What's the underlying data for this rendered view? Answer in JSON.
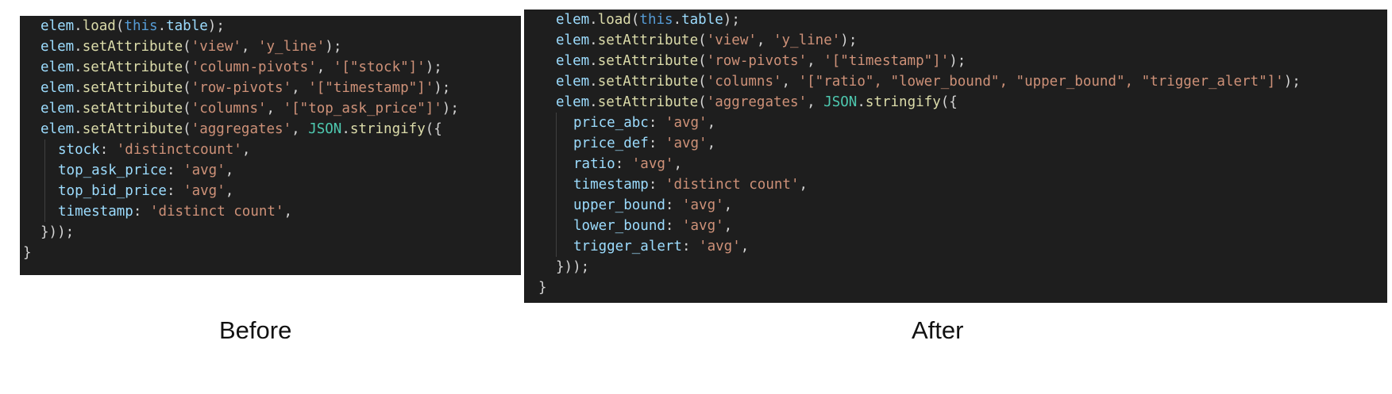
{
  "colors": {
    "background": "#1e1e1e",
    "default": "#d4d4d4",
    "identifier": "#9cdcfe",
    "keyword": "#569cd6",
    "function": "#dcdcaa",
    "string": "#ce9178",
    "class": "#4ec9b0",
    "punctuation": "#d4d4d4",
    "guide": "#404040"
  },
  "panels": [
    {
      "id": "before",
      "caption": "Before",
      "lines": [
        {
          "indent": 1,
          "tokens": [
            [
              "identifier",
              "elem"
            ],
            [
              "punctuation",
              "."
            ],
            [
              "function",
              "load"
            ],
            [
              "punctuation",
              "("
            ],
            [
              "keyword",
              "this"
            ],
            [
              "punctuation",
              "."
            ],
            [
              "identifier",
              "table"
            ],
            [
              "punctuation",
              ");"
            ]
          ]
        },
        {
          "indent": 1,
          "tokens": [
            [
              "identifier",
              "elem"
            ],
            [
              "punctuation",
              "."
            ],
            [
              "function",
              "setAttribute"
            ],
            [
              "punctuation",
              "("
            ],
            [
              "string",
              "'view'"
            ],
            [
              "punctuation",
              ", "
            ],
            [
              "string",
              "'y_line'"
            ],
            [
              "punctuation",
              ");"
            ]
          ]
        },
        {
          "indent": 1,
          "tokens": [
            [
              "identifier",
              "elem"
            ],
            [
              "punctuation",
              "."
            ],
            [
              "function",
              "setAttribute"
            ],
            [
              "punctuation",
              "("
            ],
            [
              "string",
              "'column-pivots'"
            ],
            [
              "punctuation",
              ", "
            ],
            [
              "string",
              "'[\"stock\"]'"
            ],
            [
              "punctuation",
              ");"
            ]
          ]
        },
        {
          "indent": 1,
          "tokens": [
            [
              "identifier",
              "elem"
            ],
            [
              "punctuation",
              "."
            ],
            [
              "function",
              "setAttribute"
            ],
            [
              "punctuation",
              "("
            ],
            [
              "string",
              "'row-pivots'"
            ],
            [
              "punctuation",
              ", "
            ],
            [
              "string",
              "'[\"timestamp\"]'"
            ],
            [
              "punctuation",
              ");"
            ]
          ]
        },
        {
          "indent": 1,
          "tokens": [
            [
              "identifier",
              "elem"
            ],
            [
              "punctuation",
              "."
            ],
            [
              "function",
              "setAttribute"
            ],
            [
              "punctuation",
              "("
            ],
            [
              "string",
              "'columns'"
            ],
            [
              "punctuation",
              ", "
            ],
            [
              "string",
              "'[\"top_ask_price\"]'"
            ],
            [
              "punctuation",
              ");"
            ]
          ]
        },
        {
          "indent": 1,
          "tokens": [
            [
              "identifier",
              "elem"
            ],
            [
              "punctuation",
              "."
            ],
            [
              "function",
              "setAttribute"
            ],
            [
              "punctuation",
              "("
            ],
            [
              "string",
              "'aggregates'"
            ],
            [
              "punctuation",
              ", "
            ],
            [
              "class",
              "JSON"
            ],
            [
              "punctuation",
              "."
            ],
            [
              "function",
              "stringify"
            ],
            [
              "punctuation",
              "({"
            ]
          ]
        },
        {
          "indent": 2,
          "tokens": [
            [
              "identifier",
              "stock"
            ],
            [
              "punctuation",
              ": "
            ],
            [
              "string",
              "'distinctcount'"
            ],
            [
              "punctuation",
              ","
            ]
          ]
        },
        {
          "indent": 2,
          "tokens": [
            [
              "identifier",
              "top_ask_price"
            ],
            [
              "punctuation",
              ": "
            ],
            [
              "string",
              "'avg'"
            ],
            [
              "punctuation",
              ","
            ]
          ]
        },
        {
          "indent": 2,
          "tokens": [
            [
              "identifier",
              "top_bid_price"
            ],
            [
              "punctuation",
              ": "
            ],
            [
              "string",
              "'avg'"
            ],
            [
              "punctuation",
              ","
            ]
          ]
        },
        {
          "indent": 2,
          "tokens": [
            [
              "identifier",
              "timestamp"
            ],
            [
              "punctuation",
              ": "
            ],
            [
              "string",
              "'distinct count'"
            ],
            [
              "punctuation",
              ","
            ]
          ]
        },
        {
          "indent": 1,
          "tokens": [
            [
              "punctuation",
              "}));"
            ]
          ]
        },
        {
          "indent": 0,
          "tokens": [
            [
              "punctuation",
              "}"
            ]
          ]
        }
      ]
    },
    {
      "id": "after",
      "caption": "After",
      "lines": [
        {
          "indent": 1,
          "tokens": [
            [
              "identifier",
              "elem"
            ],
            [
              "punctuation",
              "."
            ],
            [
              "function",
              "load"
            ],
            [
              "punctuation",
              "("
            ],
            [
              "keyword",
              "this"
            ],
            [
              "punctuation",
              "."
            ],
            [
              "identifier",
              "table"
            ],
            [
              "punctuation",
              ");"
            ]
          ]
        },
        {
          "indent": 1,
          "tokens": [
            [
              "identifier",
              "elem"
            ],
            [
              "punctuation",
              "."
            ],
            [
              "function",
              "setAttribute"
            ],
            [
              "punctuation",
              "("
            ],
            [
              "string",
              "'view'"
            ],
            [
              "punctuation",
              ", "
            ],
            [
              "string",
              "'y_line'"
            ],
            [
              "punctuation",
              ");"
            ]
          ]
        },
        {
          "indent": 1,
          "tokens": [
            [
              "identifier",
              "elem"
            ],
            [
              "punctuation",
              "."
            ],
            [
              "function",
              "setAttribute"
            ],
            [
              "punctuation",
              "("
            ],
            [
              "string",
              "'row-pivots'"
            ],
            [
              "punctuation",
              ", "
            ],
            [
              "string",
              "'[\"timestamp\"]'"
            ],
            [
              "punctuation",
              ");"
            ]
          ]
        },
        {
          "indent": 1,
          "tokens": [
            [
              "identifier",
              "elem"
            ],
            [
              "punctuation",
              "."
            ],
            [
              "function",
              "setAttribute"
            ],
            [
              "punctuation",
              "("
            ],
            [
              "string",
              "'columns'"
            ],
            [
              "punctuation",
              ", "
            ],
            [
              "string",
              "'[\"ratio\", \"lower_bound\", \"upper_bound\", \"trigger_alert\"]'"
            ],
            [
              "punctuation",
              ");"
            ]
          ]
        },
        {
          "indent": 1,
          "tokens": [
            [
              "identifier",
              "elem"
            ],
            [
              "punctuation",
              "."
            ],
            [
              "function",
              "setAttribute"
            ],
            [
              "punctuation",
              "("
            ],
            [
              "string",
              "'aggregates'"
            ],
            [
              "punctuation",
              ", "
            ],
            [
              "class",
              "JSON"
            ],
            [
              "punctuation",
              "."
            ],
            [
              "function",
              "stringify"
            ],
            [
              "punctuation",
              "({"
            ]
          ]
        },
        {
          "indent": 2,
          "tokens": [
            [
              "identifier",
              "price_abc"
            ],
            [
              "punctuation",
              ": "
            ],
            [
              "string",
              "'avg'"
            ],
            [
              "punctuation",
              ","
            ]
          ]
        },
        {
          "indent": 2,
          "tokens": [
            [
              "identifier",
              "price_def"
            ],
            [
              "punctuation",
              ": "
            ],
            [
              "string",
              "'avg'"
            ],
            [
              "punctuation",
              ","
            ]
          ]
        },
        {
          "indent": 2,
          "tokens": [
            [
              "identifier",
              "ratio"
            ],
            [
              "punctuation",
              ": "
            ],
            [
              "string",
              "'avg'"
            ],
            [
              "punctuation",
              ","
            ]
          ]
        },
        {
          "indent": 2,
          "tokens": [
            [
              "identifier",
              "timestamp"
            ],
            [
              "punctuation",
              ": "
            ],
            [
              "string",
              "'distinct count'"
            ],
            [
              "punctuation",
              ","
            ]
          ]
        },
        {
          "indent": 2,
          "tokens": [
            [
              "identifier",
              "upper_bound"
            ],
            [
              "punctuation",
              ": "
            ],
            [
              "string",
              "'avg'"
            ],
            [
              "punctuation",
              ","
            ]
          ]
        },
        {
          "indent": 2,
          "tokens": [
            [
              "identifier",
              "lower_bound"
            ],
            [
              "punctuation",
              ": "
            ],
            [
              "string",
              "'avg'"
            ],
            [
              "punctuation",
              ","
            ]
          ]
        },
        {
          "indent": 2,
          "tokens": [
            [
              "identifier",
              "trigger_alert"
            ],
            [
              "punctuation",
              ": "
            ],
            [
              "string",
              "'avg'"
            ],
            [
              "punctuation",
              ","
            ]
          ]
        },
        {
          "indent": 1,
          "tokens": [
            [
              "punctuation",
              "}));"
            ]
          ]
        },
        {
          "indent": 0,
          "tokens": [
            [
              "punctuation",
              "}"
            ]
          ]
        }
      ]
    }
  ]
}
